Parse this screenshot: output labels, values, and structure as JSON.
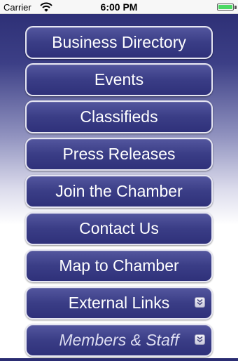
{
  "status_bar": {
    "carrier": "Carrier",
    "time": "6:00 PM",
    "battery_level": 1.0,
    "battery_color": "#4cd964"
  },
  "menu": {
    "items": [
      {
        "label": "Business Directory"
      },
      {
        "label": "Events"
      },
      {
        "label": "Classifieds"
      },
      {
        "label": "Press Releases"
      },
      {
        "label": "Join the Chamber"
      },
      {
        "label": "Contact Us"
      },
      {
        "label": "Map to Chamber"
      },
      {
        "label": "External Links",
        "icon": "double-chevron-down-icon"
      },
      {
        "label": "Members & Staff",
        "icon": "double-chevron-down-icon"
      }
    ]
  },
  "colors": {
    "button_top": "#53569e",
    "button_bottom": "#2f317a",
    "button_border": "#e6e6f2",
    "background_top": "#2a2c72"
  }
}
